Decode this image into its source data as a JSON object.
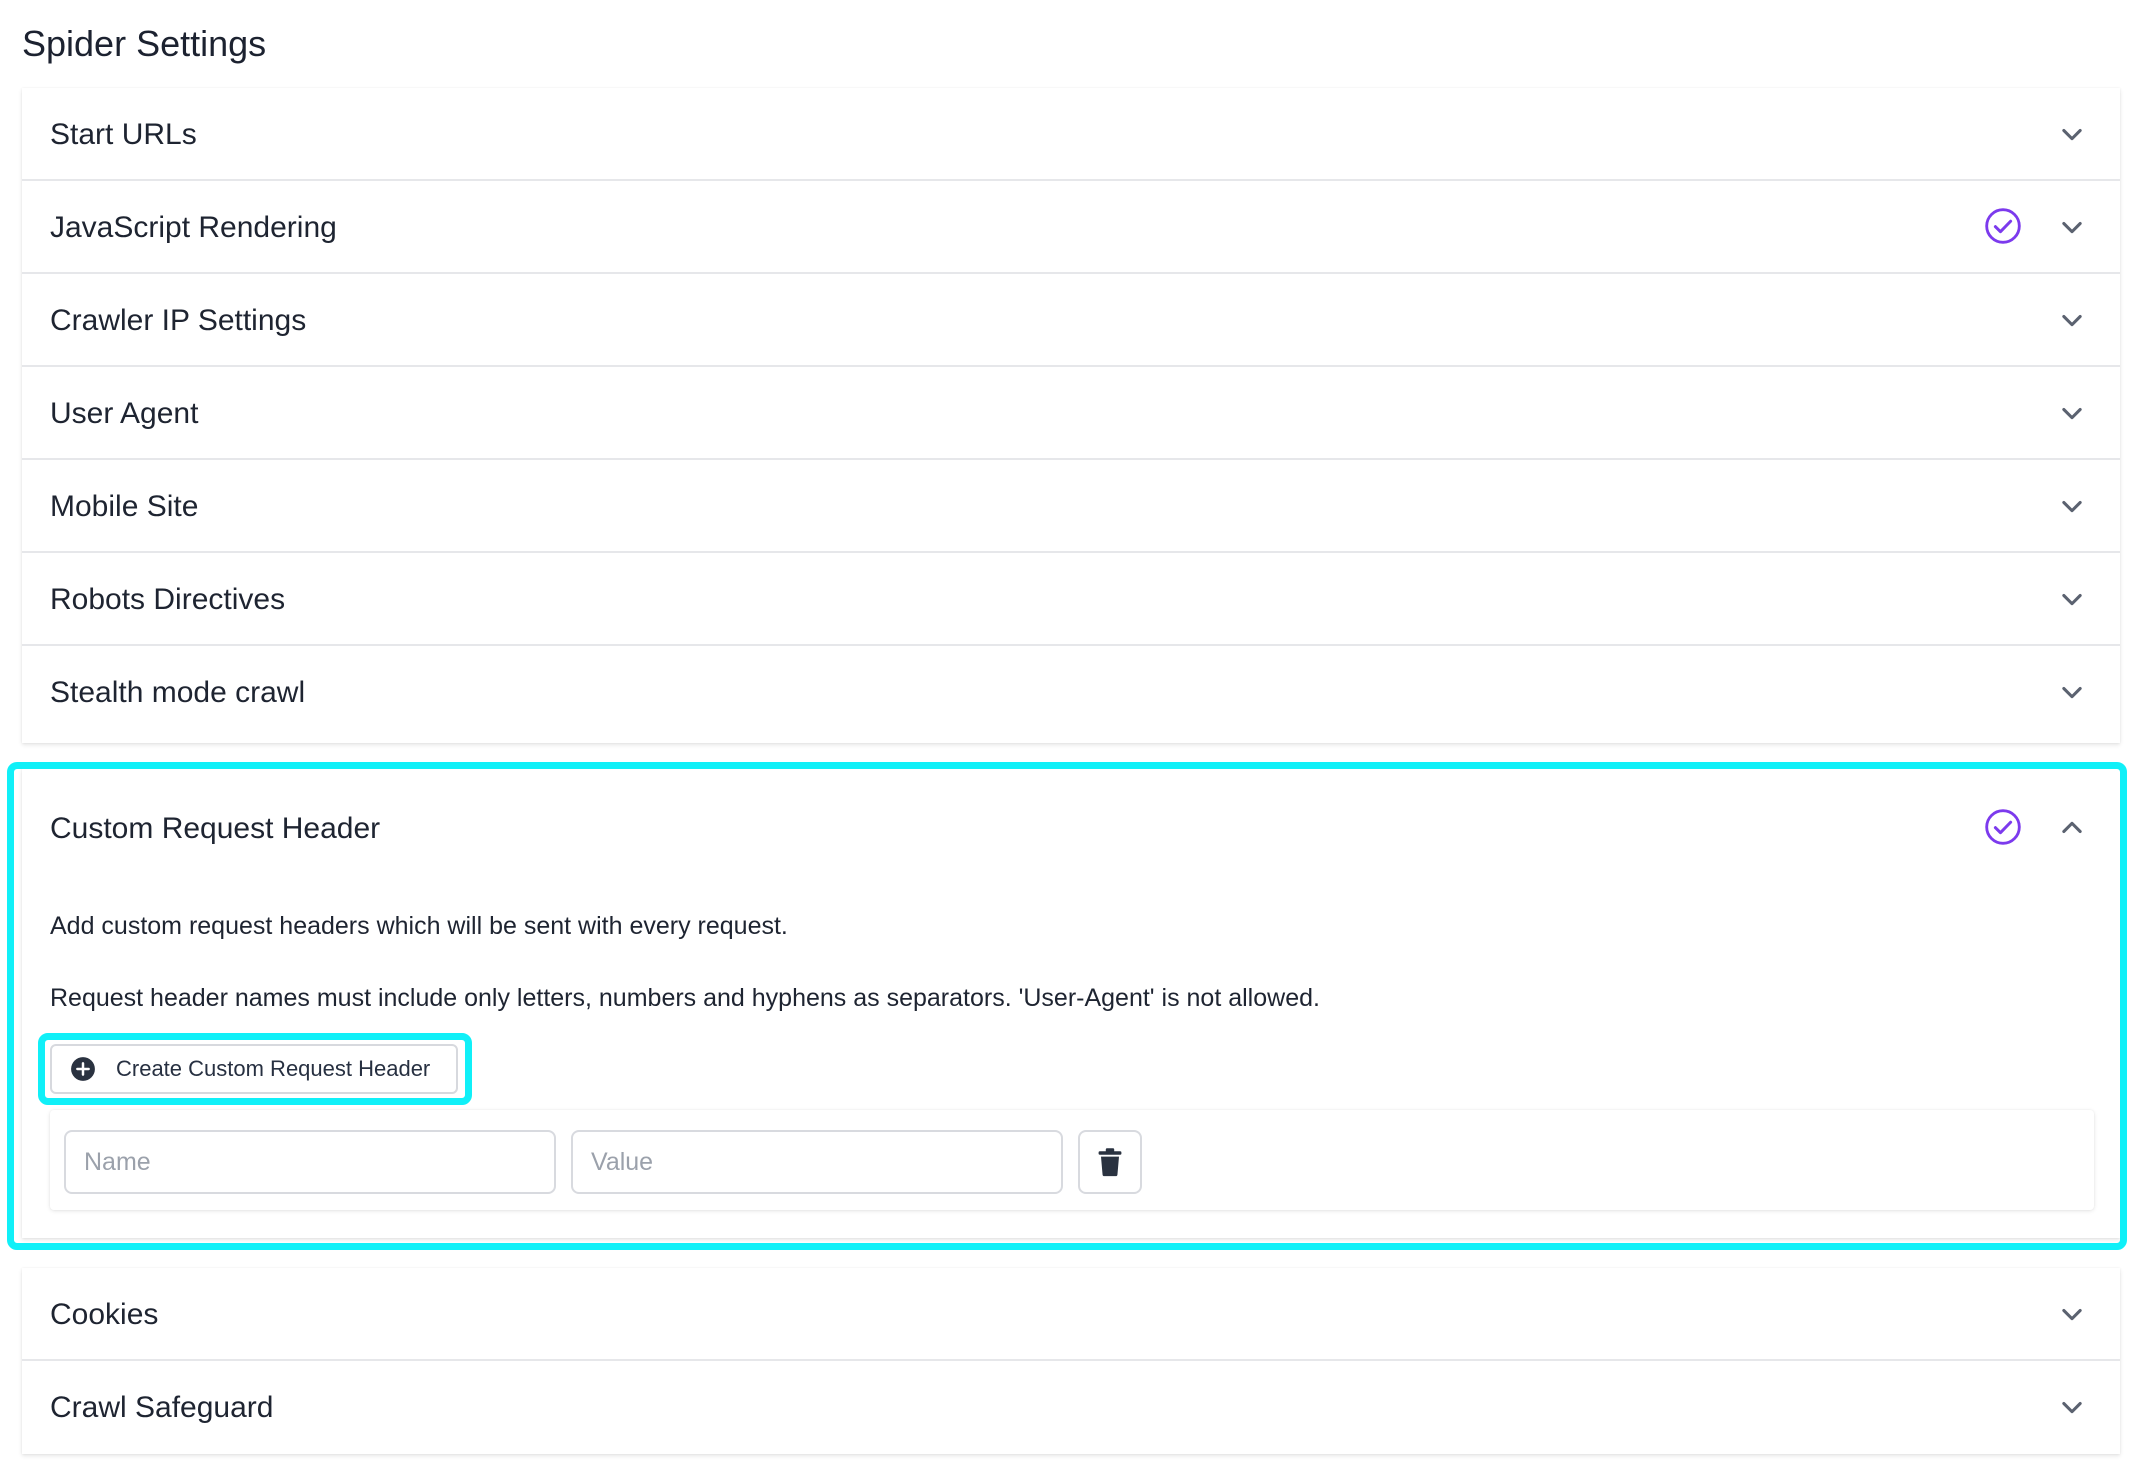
{
  "page": {
    "title": "Spider Settings"
  },
  "sections_top": [
    {
      "label": "Start URLs",
      "checked": false
    },
    {
      "label": "JavaScript Rendering",
      "checked": true
    },
    {
      "label": "Crawler IP Settings",
      "checked": false
    },
    {
      "label": "User Agent",
      "checked": false
    },
    {
      "label": "Mobile Site",
      "checked": false
    },
    {
      "label": "Robots Directives",
      "checked": false
    },
    {
      "label": "Stealth mode crawl",
      "checked": false
    }
  ],
  "expanded_section": {
    "label": "Custom Request Header",
    "checked": true,
    "description_1": "Add custom request headers which will be sent with every request.",
    "description_2": "Request header names must include only letters, numbers and hyphens as separators. 'User-Agent' is not allowed.",
    "create_button_label": "Create Custom Request Header",
    "header_row": {
      "name_placeholder": "Name",
      "name_value": "",
      "value_placeholder": "Value",
      "value_value": ""
    }
  },
  "sections_bottom": [
    {
      "label": "Cookies",
      "checked": false
    },
    {
      "label": "Crawl Safeguard",
      "checked": false
    }
  ],
  "colors": {
    "accent_check": "#7c3aed",
    "highlight": "#10f0f8",
    "chevron": "#5b6270"
  },
  "icons": {
    "collapsed": "chevron-down-icon",
    "expanded": "chevron-up-icon",
    "enabled": "check-circle-icon",
    "add": "plus-circle-icon",
    "delete": "trash-icon"
  }
}
